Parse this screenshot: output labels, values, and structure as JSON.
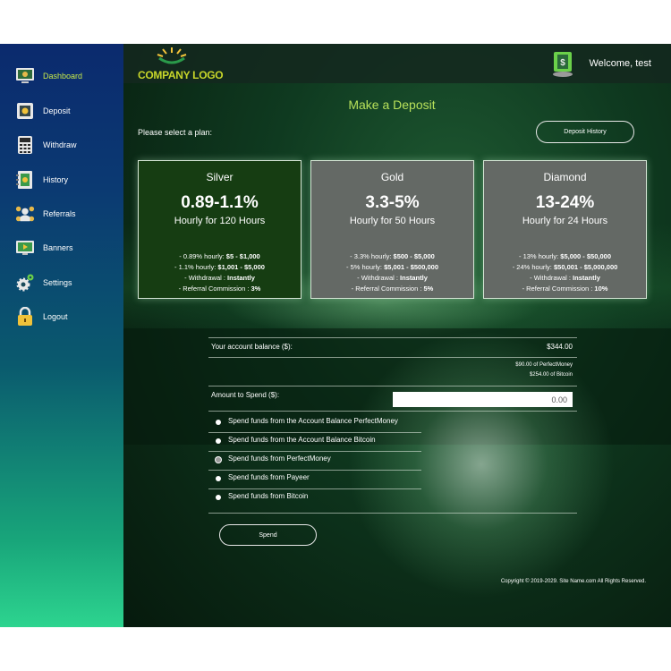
{
  "colors": {
    "accent": "#c6e84a",
    "title": "#b7e05a",
    "logo": "#c8d62a"
  },
  "sidebar": {
    "items": [
      {
        "label": "Dashboard",
        "icon": "monitor-icon",
        "active": true
      },
      {
        "label": "Deposit",
        "icon": "safe-icon"
      },
      {
        "label": "Withdraw",
        "icon": "calculator-icon"
      },
      {
        "label": "History",
        "icon": "book-icon"
      },
      {
        "label": "Referrals",
        "icon": "people-network-icon"
      },
      {
        "label": "Banners",
        "icon": "banner-screen-icon"
      },
      {
        "label": "Settings",
        "icon": "gear-icon"
      },
      {
        "label": "Logout",
        "icon": "lock-icon"
      }
    ]
  },
  "header": {
    "logo_text": "COMPANY LOGO",
    "welcome": "Welcome, test"
  },
  "main": {
    "title": "Make a Deposit",
    "select_plan": "Please select a plan:",
    "history_button": "Deposit History",
    "plans": [
      {
        "name": "Silver",
        "rate": "0.89-1.1%",
        "sub": "Hourly for 120 Hours",
        "l1": "- 0.89% hourly: ",
        "l1b": "$5 - $1,000",
        "l2": "- 1.1% hourly: ",
        "l2b": "$1,001 - $5,000",
        "l3": "- Withdrawal : ",
        "l3b": "Instantly",
        "l4": "- Referral Commission : ",
        "l4b": "3%"
      },
      {
        "name": "Gold",
        "rate": "3.3-5%",
        "sub": "Hourly for 50 Hours",
        "l1": "- 3.3% hourly: ",
        "l1b": "$500 - $5,000",
        "l2": "- 5% hourly: ",
        "l2b": "$5,001 - $500,000",
        "l3": "- Withdrawal : ",
        "l3b": "Instantly",
        "l4": "- Referral Commission : ",
        "l4b": "5%"
      },
      {
        "name": "Diamond",
        "rate": "13-24%",
        "sub": "Hourly for 24 Hours",
        "l1": "- 13% hourly: ",
        "l1b": "$5,000 - $50,000",
        "l2": "- 24% hourly: ",
        "l2b": "$50,001 - $5,000,000",
        "l3": "- Withdrawal : ",
        "l3b": "Instantly",
        "l4": "- Referral Commission : ",
        "l4b": "10%"
      }
    ],
    "balance_label": "Your account balance ($):",
    "balance_value": "$344.00",
    "balance_pm": "$90.00 of PerfectMoney",
    "balance_btc": "$254.00 of Bitcoin",
    "amount_label": "Amount to Spend ($):",
    "amount_value": "0.00",
    "options": [
      "Spend funds from the Account Balance PerfectMoney",
      "Spend funds from the Account Balance Bitcoin",
      "Spend funds from PerfectMoney",
      "Spend funds from Payeer",
      "Spend funds from Bitcoin"
    ],
    "selected_option": 2,
    "spend_button": "Spend",
    "copyright": "Copyright © 2019-2029. Site Name.com All Rights Reserved."
  }
}
